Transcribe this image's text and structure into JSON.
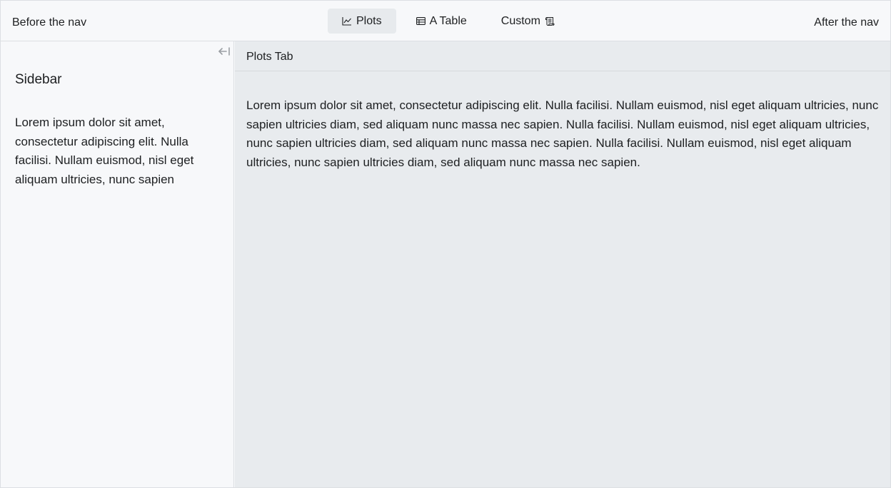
{
  "navbar": {
    "before_text": "Before the nav",
    "after_text": "After the nav",
    "tabs": [
      {
        "label": "Plots",
        "icon": "line-chart-icon",
        "active": true
      },
      {
        "label": "A Table",
        "icon": "table-icon",
        "active": false
      },
      {
        "label": "Custom",
        "icon": "scroll-icon",
        "active": false
      }
    ]
  },
  "sidebar": {
    "collapse_icon": "collapse-left-icon",
    "title": "Sidebar",
    "text": "Lorem ipsum dolor sit amet, consectetur adipiscing elit. Nulla facilisi. Nullam euismod, nisl eget aliquam ultricies, nunc sapien"
  },
  "main": {
    "header_title": "Plots Tab",
    "body_text": "Lorem ipsum dolor sit amet, consectetur adipiscing elit. Nulla facilisi. Nullam euismod, nisl eget aliquam ultricies, nunc sapien ultricies diam, sed aliquam nunc massa nec sapien. Nulla facilisi. Nullam euismod, nisl eget aliquam ultricies, nunc sapien ultricies diam, sed aliquam nunc massa nec sapien. Nulla facilisi. Nullam euismod, nisl eget aliquam ultricies, nunc sapien ultricies diam, sed aliquam nunc massa nec sapien."
  },
  "colors": {
    "navbar_bg": "#f7f8fa",
    "active_tab_bg": "#e7eaed",
    "main_bg": "#e8ebee",
    "border": "#dcdfe3",
    "text": "#1d1f21",
    "muted_icon": "#9a9ea3"
  }
}
